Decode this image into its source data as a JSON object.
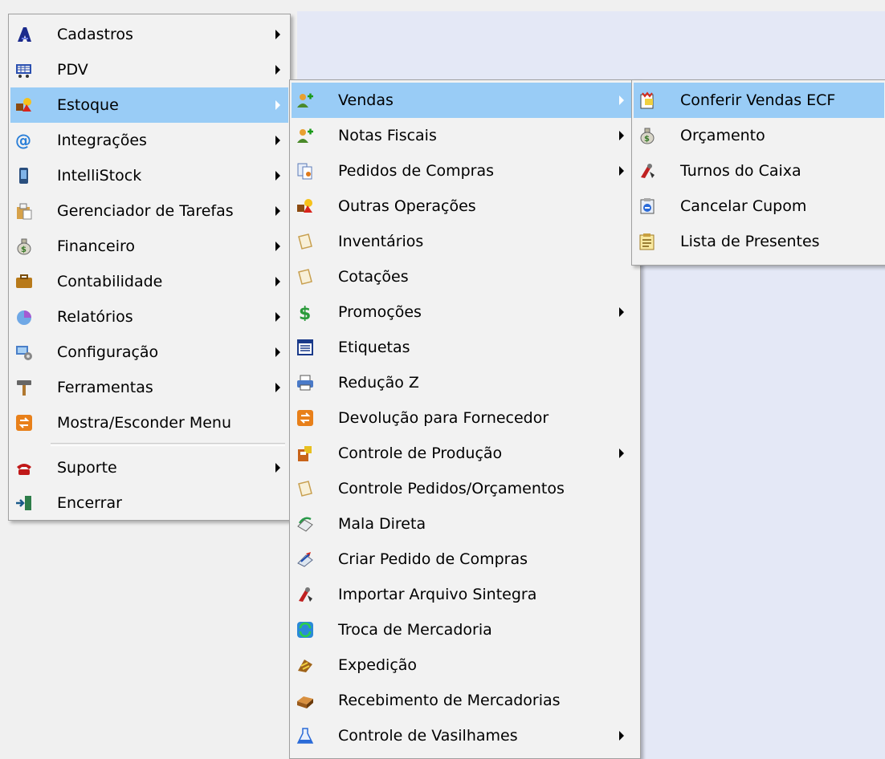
{
  "main_menu": {
    "items": [
      {
        "label": "Cadastros",
        "icon": "cadastros-icon",
        "submenu": true
      },
      {
        "label": "PDV",
        "icon": "cart-icon",
        "submenu": true
      },
      {
        "label": "Estoque",
        "icon": "estoque-icon",
        "submenu": true,
        "selected": true
      },
      {
        "label": "Integrações",
        "icon": "at-sign-icon",
        "submenu": true
      },
      {
        "label": "IntelliStock",
        "icon": "phone-device-icon",
        "submenu": true
      },
      {
        "label": "Gerenciador de Tarefas",
        "icon": "clipboard-icon",
        "submenu": true
      },
      {
        "label": "Financeiro",
        "icon": "money-bag-icon",
        "submenu": true
      },
      {
        "label": "Contabilidade",
        "icon": "briefcase-icon",
        "submenu": true
      },
      {
        "label": "Relatórios",
        "icon": "pie-chart-icon",
        "submenu": true
      },
      {
        "label": "Configuração",
        "icon": "configuration-icon",
        "submenu": true
      },
      {
        "label": "Ferramentas",
        "icon": "hammer-icon",
        "submenu": true
      },
      {
        "label": "Mostra/Esconder Menu",
        "icon": "toggle-icon",
        "submenu": false
      },
      {
        "label": "Suporte",
        "icon": "telephone-icon",
        "submenu": true
      },
      {
        "label": "Encerrar",
        "icon": "exit-icon",
        "submenu": false
      }
    ]
  },
  "estoque_menu": {
    "items": [
      {
        "label": "Vendas",
        "icon": "users-add-icon",
        "submenu": true,
        "selected": true
      },
      {
        "label": "Notas Fiscais",
        "icon": "users-add-icon",
        "submenu": true
      },
      {
        "label": "Pedidos de Compras",
        "icon": "documents-icon",
        "submenu": true
      },
      {
        "label": "Outras Operações",
        "icon": "operations-icon",
        "submenu": false
      },
      {
        "label": "Inventários",
        "icon": "notepad-icon",
        "submenu": false
      },
      {
        "label": "Cotações",
        "icon": "notepad-icon",
        "submenu": false
      },
      {
        "label": "Promoções",
        "icon": "dollar-icon",
        "submenu": true
      },
      {
        "label": "Etiquetas",
        "icon": "labels-icon",
        "submenu": false
      },
      {
        "label": "Redução Z",
        "icon": "printer-icon",
        "submenu": false
      },
      {
        "label": "Devolução para Fornecedor",
        "icon": "return-icon",
        "submenu": false
      },
      {
        "label": "Controle de Produção",
        "icon": "production-icon",
        "submenu": true
      },
      {
        "label": "Controle Pedidos/Orçamentos",
        "icon": "notepad-icon",
        "submenu": false
      },
      {
        "label": "Mala Direta",
        "icon": "mail-icon",
        "submenu": false
      },
      {
        "label": "Criar Pedido de Compras",
        "icon": "create-order-icon",
        "submenu": false
      },
      {
        "label": "Importar Arquivo Sintegra",
        "icon": "import-icon",
        "submenu": false
      },
      {
        "label": "Troca de Mercadoria",
        "icon": "exchange-icon",
        "submenu": false
      },
      {
        "label": "Expedição",
        "icon": "shipping-icon",
        "submenu": false
      },
      {
        "label": "Recebimento de Mercadorias",
        "icon": "receiving-icon",
        "submenu": false
      },
      {
        "label": "Controle de Vasilhames",
        "icon": "flask-icon",
        "submenu": true
      }
    ]
  },
  "vendas_menu": {
    "items": [
      {
        "label": "Conferir Vendas ECF",
        "icon": "receipt-check-icon",
        "submenu": false,
        "selected": true
      },
      {
        "label": "Orçamento",
        "icon": "money-bag-icon",
        "submenu": false
      },
      {
        "label": "Turnos do Caixa",
        "icon": "shifts-icon",
        "submenu": false
      },
      {
        "label": "Cancelar Cupom",
        "icon": "cancel-coupon-icon",
        "submenu": false
      },
      {
        "label": "Lista de Presentes",
        "icon": "gift-list-icon",
        "submenu": false
      }
    ]
  },
  "colors": {
    "highlight": "#99ccf6",
    "menu_bg": "#f2f2f2",
    "desktop": "#e4e8f6"
  }
}
